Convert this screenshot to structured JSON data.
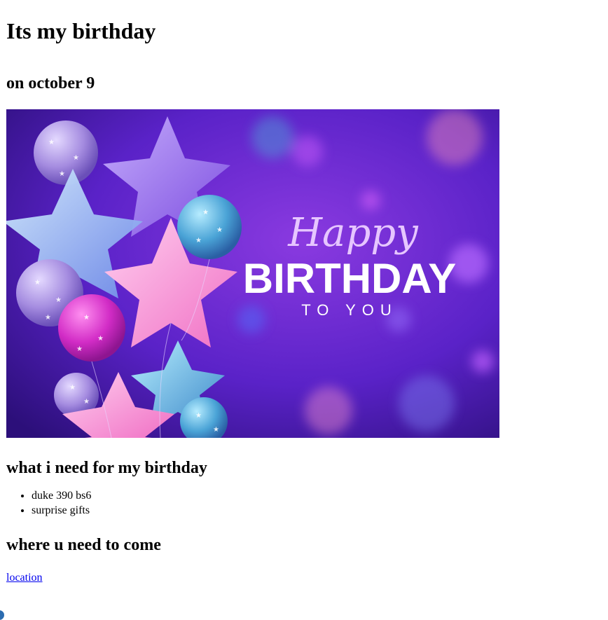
{
  "page": {
    "title": "Its my birthday",
    "date": "on october 9"
  },
  "banner": {
    "script_text": "Happy",
    "main_text": "BIRTHDAY",
    "sub_text": "TO YOU",
    "colors": {
      "background_dark": "#3a1494",
      "background_mid": "#6a2bd6",
      "balloon_pink": "#f29ad6",
      "balloon_magenta": "#d62fc8",
      "balloon_teal": "#4fa8d8",
      "balloon_lilac": "#a58ce0"
    }
  },
  "needs": {
    "heading": "what i need for my birthday",
    "items": [
      "duke 390 bs6",
      "surprise gifts"
    ]
  },
  "venue": {
    "heading": "where u need to come",
    "link_label": "location"
  }
}
